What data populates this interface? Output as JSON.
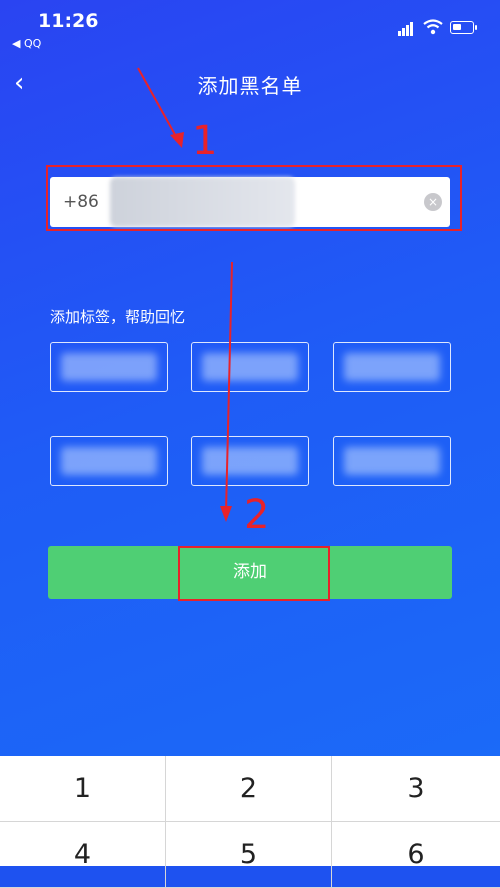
{
  "status": {
    "time": "11:26",
    "back_app": "◀ QQ"
  },
  "nav": {
    "back_icon": "‹",
    "title": "添加黑名单"
  },
  "phone_input": {
    "prefix": "+86",
    "clear_icon": "×"
  },
  "tags": {
    "hint": "添加标签，帮助回忆"
  },
  "add_button": {
    "label": "添加"
  },
  "annotations": {
    "step1": "1",
    "step2": "2",
    "color": "#e8222a"
  },
  "keypad": {
    "keys": [
      "1",
      "2",
      "3",
      "4",
      "5",
      "6"
    ]
  },
  "colors": {
    "button": "#4fcf74",
    "background": "#1f5cf6"
  }
}
